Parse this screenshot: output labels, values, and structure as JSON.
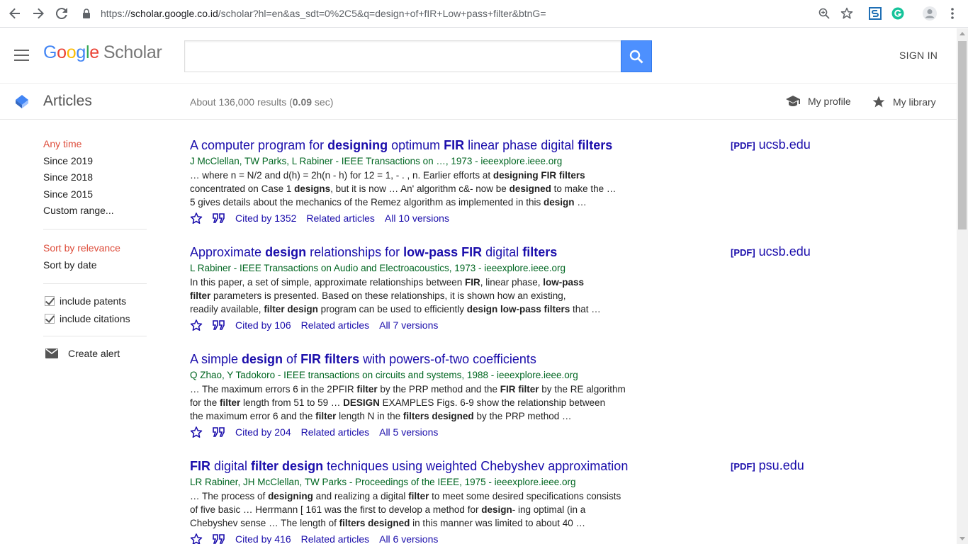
{
  "browser": {
    "url_prefix": "https://",
    "url_host": "scholar.google.co.id",
    "url_path": "/scholar?hl=en&as_sdt=0%2C5&q=design+of+fIR+Low+pass+filter&btnG="
  },
  "header": {
    "logo_letters": [
      "G",
      "o",
      "o",
      "g",
      "l",
      "e"
    ],
    "logo_suffix": "Scholar",
    "search_value": "",
    "signin_label": "SIGN IN"
  },
  "subheader": {
    "articles_label": "Articles",
    "results_prefix": "About 136,000 results (",
    "results_time": "0.09",
    "results_suffix": " sec)",
    "profile_label": "My profile",
    "library_label": "My library"
  },
  "sidebar": {
    "time_filters": [
      "Any time",
      "Since 2019",
      "Since 2018",
      "Since 2015",
      "Custom range..."
    ],
    "sort_options": [
      "Sort by relevance",
      "Sort by date"
    ],
    "include_patents": "include patents",
    "include_citations": "include citations",
    "create_alert": "Create alert"
  },
  "results": [
    {
      "title_parts": [
        [
          "A computer program for ",
          false
        ],
        [
          "designing",
          true
        ],
        [
          " optimum ",
          false
        ],
        [
          "FIR",
          true
        ],
        [
          " linear phase digital ",
          false
        ],
        [
          "filters",
          true
        ]
      ],
      "meta": "J McClellan, TW Parks, L Rabiner - IEEE Transactions on …, 1973 - ieeexplore.ieee.org",
      "snippet_lines": [
        [
          [
            "… where n = N/2 and d(h) = 2h(n - h) for 12 = 1, - . , n. Earlier efforts at ",
            false
          ],
          [
            "designing FIR filters",
            true
          ]
        ],
        [
          [
            "concentrated on Case 1 ",
            false
          ],
          [
            "designs",
            true
          ],
          [
            ", but it is now … An' algorithm c&- now be ",
            false
          ],
          [
            "designed",
            true
          ],
          [
            " to make the …",
            false
          ]
        ],
        [
          [
            "5 gives details about the mechanics of the Remez algorithm as implemented in this ",
            false
          ],
          [
            "design",
            true
          ],
          [
            " …",
            false
          ]
        ]
      ],
      "cited_by": "Cited by 1352",
      "related": "Related articles",
      "versions": "All 10 versions",
      "pdf_tag": "[PDF]",
      "pdf_source": "ucsb.edu"
    },
    {
      "title_parts": [
        [
          "Approximate ",
          false
        ],
        [
          "design",
          true
        ],
        [
          " relationships for ",
          false
        ],
        [
          "low-pass FIR",
          true
        ],
        [
          " digital ",
          false
        ],
        [
          "filters",
          true
        ]
      ],
      "meta": "L Rabiner - IEEE Transactions on Audio and Electroacoustics, 1973 - ieeexplore.ieee.org",
      "snippet_lines": [
        [
          [
            "In this paper, a set of simple, approximate relationships between ",
            false
          ],
          [
            "FIR",
            true
          ],
          [
            ", linear phase, ",
            false
          ],
          [
            "low-pass",
            true
          ]
        ],
        [
          [
            "filter",
            true
          ],
          [
            " parameters is presented. Based on these relationships, it is shown how an existing,",
            false
          ]
        ],
        [
          [
            "readily available, ",
            false
          ],
          [
            "filter design",
            true
          ],
          [
            " program can be used to efficiently ",
            false
          ],
          [
            "design low-pass filters",
            true
          ],
          [
            " that …",
            false
          ]
        ]
      ],
      "cited_by": "Cited by 106",
      "related": "Related articles",
      "versions": "All 7 versions",
      "pdf_tag": "[PDF]",
      "pdf_source": "ucsb.edu"
    },
    {
      "title_parts": [
        [
          "A simple ",
          false
        ],
        [
          "design",
          true
        ],
        [
          " of ",
          false
        ],
        [
          "FIR filters",
          true
        ],
        [
          " with powers-of-two coefficients",
          false
        ]
      ],
      "meta": "Q Zhao, Y Tadokoro - IEEE transactions on circuits and systems, 1988 - ieeexplore.ieee.org",
      "snippet_lines": [
        [
          [
            "… The maximum errors 6 in the 2PFIR ",
            false
          ],
          [
            "filter",
            true
          ],
          [
            " by the PRP method and the ",
            false
          ],
          [
            "FIR filter",
            true
          ],
          [
            " by the RE algorithm",
            false
          ]
        ],
        [
          [
            "for the ",
            false
          ],
          [
            "filter",
            true
          ],
          [
            " length from 51 to 59 … ",
            false
          ],
          [
            "DESIGN",
            true
          ],
          [
            " EXAMPLES Figs. 6-9 show the relationship between",
            false
          ]
        ],
        [
          [
            "the maximum error 6 and the ",
            false
          ],
          [
            "filter",
            true
          ],
          [
            " length N in the ",
            false
          ],
          [
            "filters designed",
            true
          ],
          [
            " by the PRP method …",
            false
          ]
        ]
      ],
      "cited_by": "Cited by 204",
      "related": "Related articles",
      "versions": "All 5 versions",
      "pdf_tag": "",
      "pdf_source": ""
    },
    {
      "title_parts": [
        [
          "FIR",
          true
        ],
        [
          " digital ",
          false
        ],
        [
          "filter design",
          true
        ],
        [
          " techniques using weighted Chebyshev approximation",
          false
        ]
      ],
      "meta": "LR Rabiner, JH McClellan, TW Parks - Proceedings of the IEEE, 1975 - ieeexplore.ieee.org",
      "snippet_lines": [
        [
          [
            "… The process of ",
            false
          ],
          [
            "designing",
            true
          ],
          [
            " and realizing a digital ",
            false
          ],
          [
            "filter",
            true
          ],
          [
            " to meet some desired specifications consists",
            false
          ]
        ],
        [
          [
            "of five basic … Herrmann [ 161 was the first to develop a method for ",
            false
          ],
          [
            "design",
            true
          ],
          [
            "- ing optimal (in a",
            false
          ]
        ],
        [
          [
            "Chebyshev sense … The length of ",
            false
          ],
          [
            "filters designed",
            true
          ],
          [
            " in this manner was limited to about 40 …",
            false
          ]
        ]
      ],
      "cited_by": "Cited by 416",
      "related": "Related articles",
      "versions": "All 6 versions",
      "pdf_tag": "[PDF]",
      "pdf_source": "psu.edu"
    }
  ],
  "colors": {
    "link": "#1a0dab",
    "meta": "#006621",
    "active_filter": "#dd4b39",
    "search_button": "#4d90fe"
  }
}
